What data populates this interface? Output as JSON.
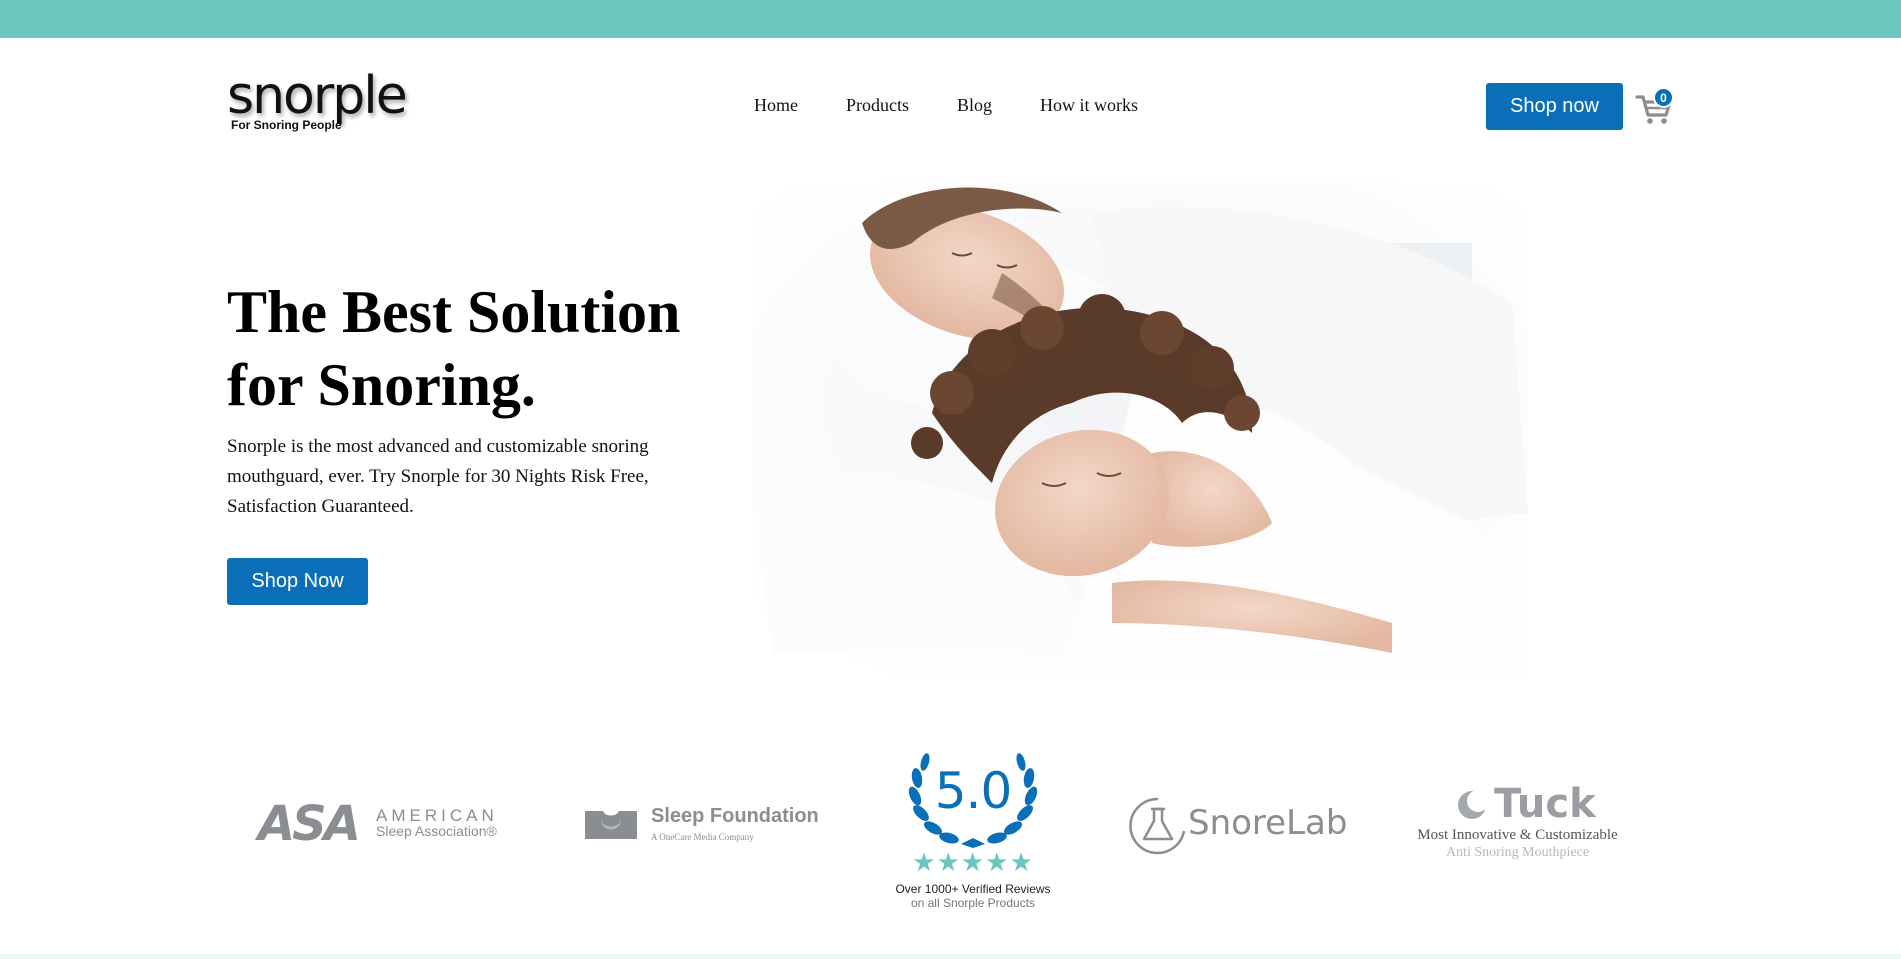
{
  "header": {
    "logo_word": "snorple",
    "logo_tagline": "For Snoring People",
    "nav": [
      "Home",
      "Products",
      "Blog",
      "How it works"
    ],
    "shop_button": "Shop now",
    "cart_count": "0",
    "cart_icon": "cart-icon"
  },
  "hero": {
    "title_line1": "The Best Solution",
    "title_line2": "for Snoring.",
    "text": "Snorple is the most advanced and customizable snoring mouthguard, ever. Try Snorple for 30 Nights Risk Free, Satisfaction Guaranteed.",
    "button": "Shop Now"
  },
  "brands": {
    "asa": {
      "mark": "ASA",
      "line1": "AMERICAN",
      "line2": "Sleep Association®"
    },
    "sleep_foundation": {
      "name": "Sleep Foundation",
      "sub": "A OneCare Media Company"
    },
    "rating": {
      "score": "5.0",
      "stars": "★★★★★",
      "line1": "Over 1000+ Verified Reviews",
      "line2": "on all Snorple Products"
    },
    "snorelab": {
      "name": "SnoreLab"
    },
    "tuck": {
      "name": "Tuck",
      "line1": "Most Innovative & Customizable",
      "line2": "Anti Snoring Mouthpiece"
    }
  },
  "colors": {
    "accent_teal": "#6bc7bd",
    "button_blue": "#0a6fb8",
    "logo_gray": "#8a8e93"
  }
}
